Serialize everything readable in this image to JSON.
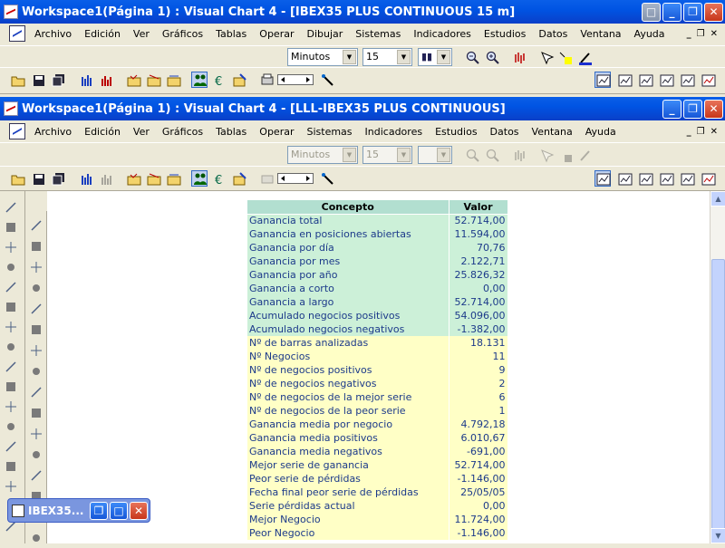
{
  "outer_window": {
    "title": "Workspace1(Página 1) : Visual Chart 4 - [IBEX35 PLUS CONTINUOUS 15 m]",
    "menu": [
      "Archivo",
      "Edición",
      "Ver",
      "Gráficos",
      "Tablas",
      "Operar",
      "Dibujar",
      "Sistemas",
      "Indicadores",
      "Estudios",
      "Datos",
      "Ventana",
      "Ayuda"
    ],
    "timeframe": "Minutos",
    "interval": "15"
  },
  "inner_window": {
    "title": "Workspace1(Página 1) : Visual Chart 4 - [LLL-IBEX35 PLUS CONTINUOUS]",
    "menu": [
      "Archivo",
      "Edición",
      "Ver",
      "Gráficos",
      "Tablas",
      "Operar",
      "Sistemas",
      "Indicadores",
      "Estudios",
      "Datos",
      "Ventana",
      "Ayuda"
    ],
    "timeframe": "Minutos",
    "interval": "15"
  },
  "report": {
    "header_concept": "Concepto",
    "header_value": "Valor",
    "rows": [
      {
        "label": "Ganancia total",
        "value": "52.714,00",
        "style": "g"
      },
      {
        "label": "Ganancia en posiciones abiertas",
        "value": "11.594,00",
        "style": "g"
      },
      {
        "label": "Ganancia por día",
        "value": "70,76",
        "style": "g"
      },
      {
        "label": "Ganancia por mes",
        "value": "2.122,71",
        "style": "g"
      },
      {
        "label": "Ganancia por año",
        "value": "25.826,32",
        "style": "g"
      },
      {
        "label": "Ganancia a corto",
        "value": "0,00",
        "style": "g"
      },
      {
        "label": "Ganancia a largo",
        "value": "52.714,00",
        "style": "g"
      },
      {
        "label": "Acumulado negocios positivos",
        "value": "54.096,00",
        "style": "g"
      },
      {
        "label": "Acumulado negocios negativos",
        "value": "-1.382,00",
        "style": "g"
      },
      {
        "label": "Nº de barras analizadas",
        "value": "18.131",
        "style": "y"
      },
      {
        "label": "Nº Negocios",
        "value": "11",
        "style": "y"
      },
      {
        "label": "Nº de negocios positivos",
        "value": "9",
        "style": "y"
      },
      {
        "label": "Nº de negocios negativos",
        "value": "2",
        "style": "y"
      },
      {
        "label": "Nº de negocios de la mejor serie",
        "value": "6",
        "style": "y"
      },
      {
        "label": "Nº de negocios de la peor serie",
        "value": "1",
        "style": "y"
      },
      {
        "label": "Ganancia media por negocio",
        "value": "4.792,18",
        "style": "y"
      },
      {
        "label": "Ganancia media positivos",
        "value": "6.010,67",
        "style": "y"
      },
      {
        "label": "Ganancia media negativos",
        "value": "-691,00",
        "style": "y"
      },
      {
        "label": "Mejor serie de ganancia",
        "value": "52.714,00",
        "style": "y"
      },
      {
        "label": "Peor serie de pérdidas",
        "value": "-1.146,00",
        "style": "y"
      },
      {
        "label": "Fecha final peor serie de pérdidas",
        "value": "25/05/05",
        "style": "y"
      },
      {
        "label": "Serie pérdidas actual",
        "value": "0,00",
        "style": "y"
      },
      {
        "label": "Mejor Negocio",
        "value": "11.724,00",
        "style": "y"
      },
      {
        "label": "Peor Negocio",
        "value": "-1.146,00",
        "style": "y"
      }
    ]
  },
  "taskbar_item": "IBEX35..."
}
